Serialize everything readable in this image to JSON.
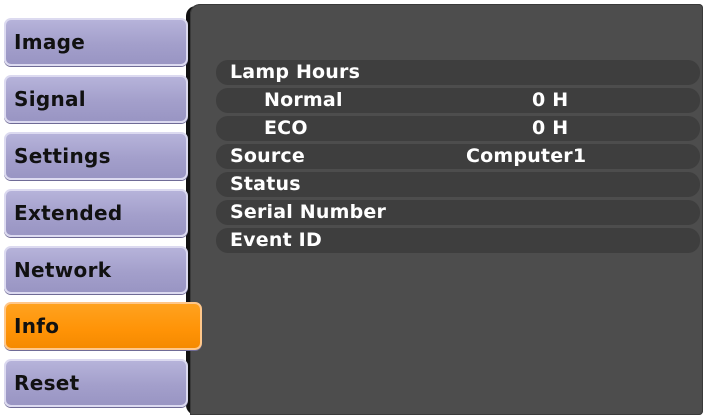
{
  "menu": {
    "tabs": [
      {
        "label": "Image"
      },
      {
        "label": "Signal"
      },
      {
        "label": "Settings"
      },
      {
        "label": "Extended"
      },
      {
        "label": "Network"
      },
      {
        "label": "Info",
        "active": true
      },
      {
        "label": "Reset"
      }
    ],
    "active_color": "#ff9306",
    "tab_color": "#a9a5cf"
  },
  "info": {
    "rows": [
      {
        "label": "Lamp Hours",
        "value": ""
      },
      {
        "label": "Normal",
        "value": "0 H"
      },
      {
        "label": "ECO",
        "value": "0 H"
      },
      {
        "label": "Source",
        "value": "Computer1"
      },
      {
        "label": "Status",
        "value": ""
      },
      {
        "label": "Serial Number",
        "value": ""
      },
      {
        "label": "Event ID",
        "value": ""
      }
    ]
  }
}
